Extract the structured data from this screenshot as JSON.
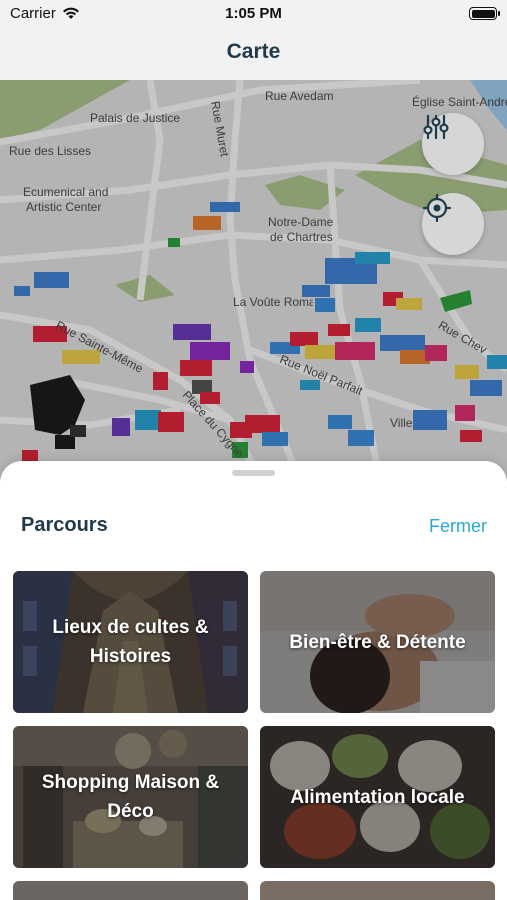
{
  "status_bar": {
    "carrier": "Carrier",
    "time": "1:05 PM"
  },
  "nav": {
    "title": "Carte"
  },
  "map": {
    "labels": {
      "rue_avedam": "Rue Avedam",
      "eglise": "Église Saint-André",
      "palais": "Palais de Justice",
      "rue_muret": "Rue Muret",
      "rue_lisses": "Rue des Lisses",
      "ecumenical_1": "Ecumenical and",
      "ecumenical_2": "Artistic Center",
      "notre_dame_1": "Notre-Dame",
      "notre_dame_2": "de Chartres",
      "voute": "La Voûte Romane",
      "sainte_meme": "Rue Sainte-Même",
      "noel_parfait": "Rue Noël Parfait",
      "place": "Place du Cygne",
      "rue_chevalier": "Rue Chev",
      "ville": "Ville"
    },
    "filter_icon": "sliders-icon",
    "locate_icon": "crosshair-icon"
  },
  "sheet": {
    "title": "Parcours",
    "close_label": "Fermer",
    "cards": [
      {
        "label": "Lieux de cultes & Histoires",
        "theme": "cathedral-interior"
      },
      {
        "label": "Bien-être & Détente",
        "theme": "spa-massage"
      },
      {
        "label": "Shopping Maison & Déco",
        "theme": "home-decor-shop"
      },
      {
        "label": "Alimentation locale",
        "theme": "local-produce"
      }
    ]
  },
  "colors": {
    "accent": "#2aa8d8",
    "title": "#1e3a4c"
  }
}
